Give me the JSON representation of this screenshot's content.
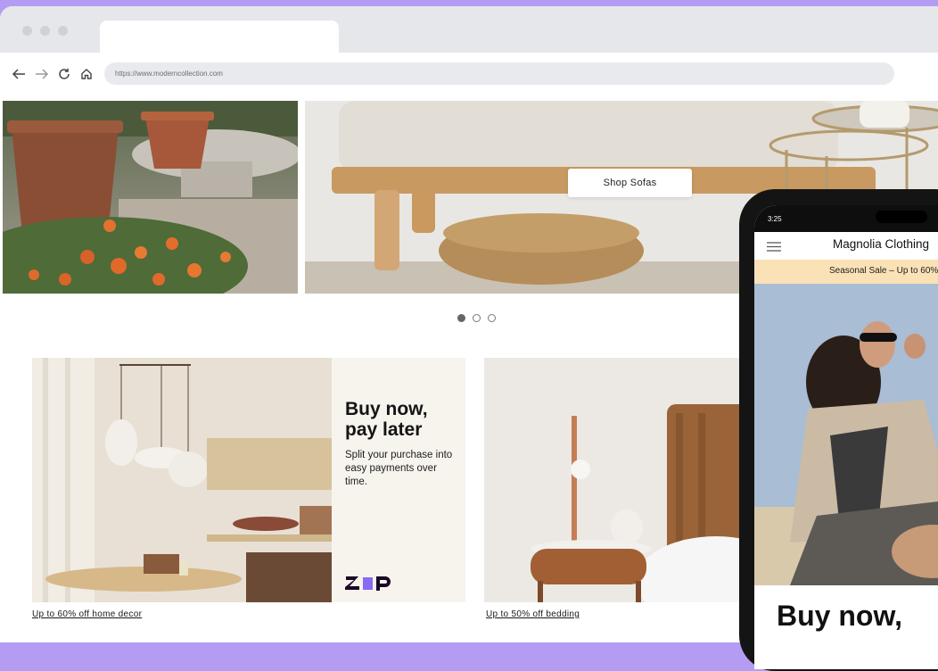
{
  "browser": {
    "url": "https://www.moderncollection.com"
  },
  "hero": {
    "cta_label": "Shop Sofas",
    "carousel": {
      "count": 3,
      "active": 1
    }
  },
  "promo": {
    "headline": "Buy now, pay later",
    "subtext": "Split your purchase into easy payments over time.",
    "logo": "zip",
    "brand_color": "#8a6cf4",
    "link_home_decor": "Up to 60% off home decor",
    "link_bedding": "Up to 50% off bedding"
  },
  "phone": {
    "time": "3:25",
    "store_title": "Magnolia Clothing",
    "banner": "Seasonal Sale – Up to 60%",
    "bnpl_headline": "Buy now,"
  },
  "colors": {
    "background": "#b49cf2",
    "banner": "#fae2b6",
    "zip_panel": "#f7f4ee"
  }
}
